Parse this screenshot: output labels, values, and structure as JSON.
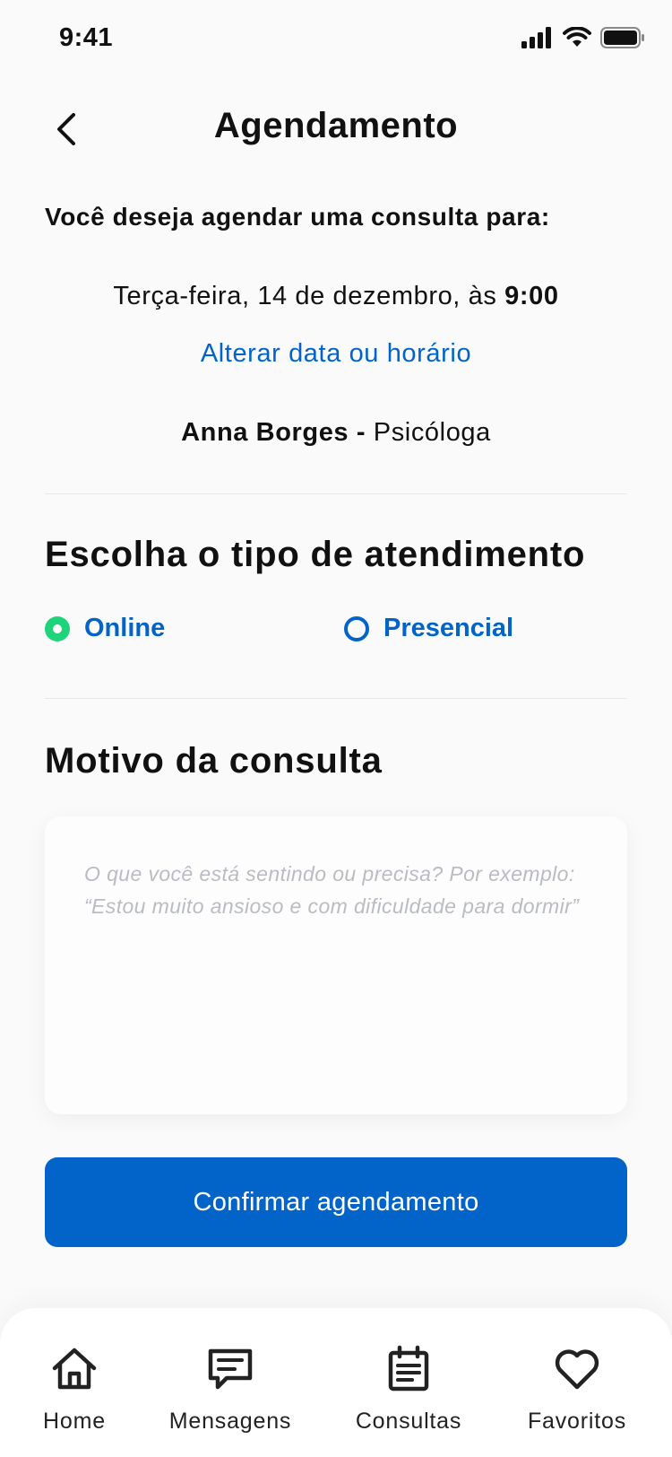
{
  "status_bar": {
    "time": "9:41"
  },
  "header": {
    "title": "Agendamento"
  },
  "summary": {
    "question": "Você deseja agendar uma consulta para:",
    "date_text": "Terça-feira, 14 de dezembro, às ",
    "time": "9:00",
    "change_link": "Alterar data ou horário",
    "professional_name": "Anna Borges",
    "separator": " - ",
    "professional_role": "Psicóloga"
  },
  "attendance": {
    "title": "Escolha o tipo de atendimento",
    "options": [
      {
        "label": "Online",
        "selected": true
      },
      {
        "label": "Presencial",
        "selected": false
      }
    ]
  },
  "reason": {
    "title": "Motivo da consulta",
    "placeholder_line1": "O que você está sentindo ou precisa? Por exemplo:",
    "placeholder_line2": "“Estou muito ansioso e com dificuldade para dormir”"
  },
  "confirm_button": {
    "label": "Confirmar agendamento"
  },
  "bottom_nav": {
    "items": [
      {
        "label": "Home",
        "icon": "home-icon"
      },
      {
        "label": "Mensagens",
        "icon": "message-icon"
      },
      {
        "label": "Consultas",
        "icon": "clipboard-icon"
      },
      {
        "label": "Favoritos",
        "icon": "heart-icon"
      }
    ]
  },
  "colors": {
    "primary": "#0264C9",
    "selected": "#1ED47A",
    "background": "#FAFAFA",
    "placeholder": "#B9BCC1"
  }
}
